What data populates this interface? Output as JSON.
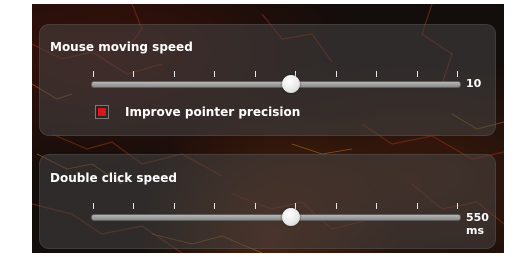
{
  "colors": {
    "panel_bg": "#464646",
    "text": "#ffffff",
    "checkbox_mark": "#e01414",
    "track": "#a0a0a0",
    "background": "#130d0b"
  },
  "mouse_speed": {
    "title": "Mouse moving speed",
    "value_text": "10",
    "level": 0.54,
    "tick_count": 10
  },
  "pointer_precision": {
    "label": "Improve pointer precision",
    "checked": true
  },
  "double_click": {
    "title": "Double click speed",
    "value_text": "550 ms",
    "level": 0.54,
    "tick_count": 10
  }
}
